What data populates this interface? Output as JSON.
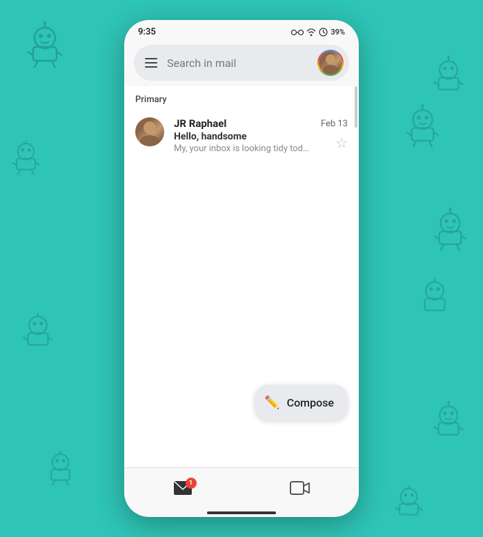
{
  "background": {
    "color": "#2ec4b6"
  },
  "status_bar": {
    "time": "9:35",
    "battery": "39%",
    "battery_color": "#222"
  },
  "search": {
    "placeholder": "Search in mail"
  },
  "section": {
    "label": "Primary"
  },
  "email": {
    "sender": "JR Raphael",
    "subject": "Hello, handsome",
    "preview": "My, your inbox is looking tidy today!",
    "date": "Feb 13"
  },
  "compose": {
    "label": "Compose"
  },
  "nav": {
    "mail_badge": "1",
    "items": [
      "mail",
      "meet"
    ]
  }
}
